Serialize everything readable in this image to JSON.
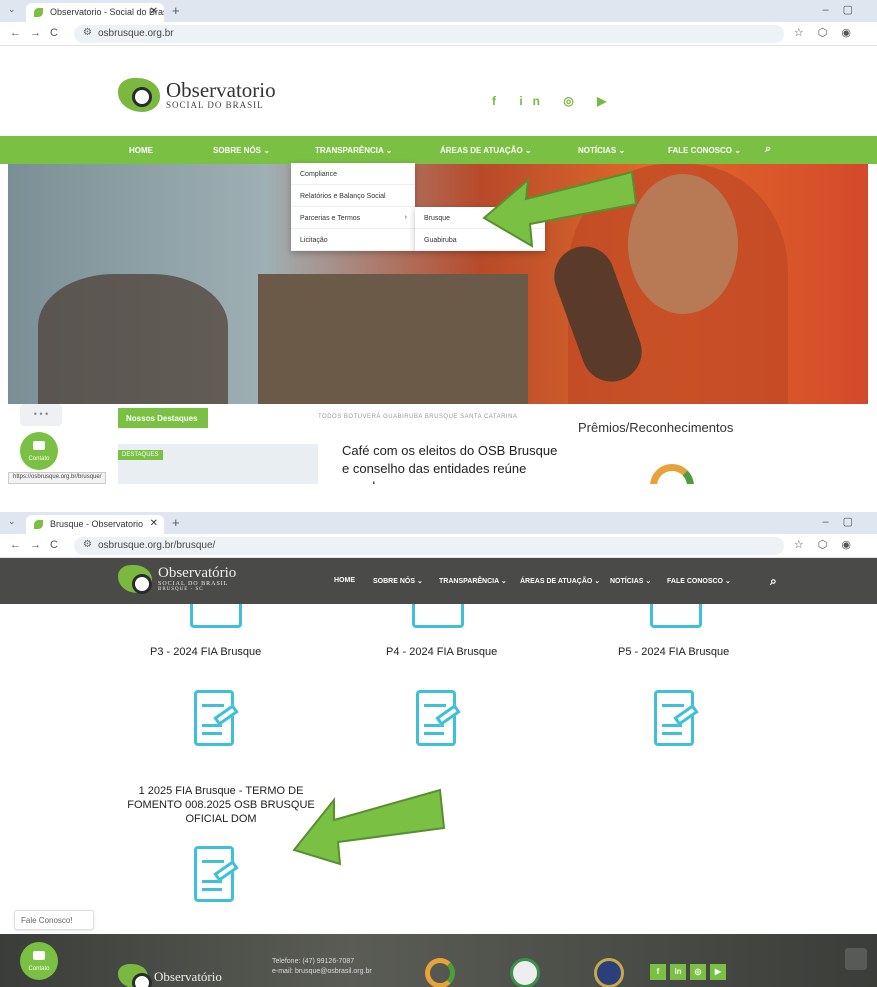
{
  "shot1": {
    "tab_title": "Observatorio - Social do Brasi",
    "url": "osbrusque.org.br",
    "logo": {
      "title": "Observatorio",
      "subtitle": "SOCIAL DO BRASIL"
    },
    "social": "f in ◎ ▶",
    "menu": [
      "HOME",
      "SOBRE NÓS ⌄",
      "TRANSPARÊNCIA ⌄",
      "ÁREAS DE ATUAÇÃO ⌄",
      "NOTÍCIAS ⌄",
      "FALE CONOSCO ⌄"
    ],
    "dropdown": [
      "Compliance",
      "Relatórios e Balanço Social",
      "Parcerias e Termos",
      "Licitação"
    ],
    "submenu": [
      "Brusque",
      "Guabiruba"
    ],
    "highlights_label": "Nossos Destaques",
    "filters": "TODOS   BOTUVERÁ   GUABIRUBA   BRUSQUE   SANTA CATARINA",
    "awards": "Prêmios/Reconhecimentos",
    "news_title": "Café com os eleitos do OSB Brusque e conselho das entidades reúne grande",
    "thumb_tag": "DESTAQUES",
    "status_url": "https://osbrusque.org.br/brusque/",
    "dots": "• • •",
    "chat_label": "Contato"
  },
  "shot2": {
    "tab_title": "Brusque - Observatorio",
    "url": "osbrusque.org.br/brusque/",
    "logo": {
      "title": "Observatório",
      "subtitle": "SOCIAL DO BRASIL",
      "sub2": "BRUSQUE - SC"
    },
    "menu": [
      "HOME",
      "SOBRE NÓS ⌄",
      "TRANSPARÊNCIA ⌄",
      "ÁREAS DE ATUAÇÃO ⌄",
      "NOTÍCIAS ⌄",
      "FALE CONOSCO ⌄"
    ],
    "docs": [
      "P3 - 2024 FIA Brusque",
      "P4 - 2024 FIA Brusque",
      "P5 - 2024 FIA Brusque"
    ],
    "doc_long": [
      "1 2025 FIA Brusque - TERMO DE",
      "FOMENTO 008.2025 OSB BRUSQUE",
      "OFICIAL DOM"
    ],
    "fale": "Fale Conosco!",
    "footer_logo": "Observatório",
    "footer_tel": "Telefone: (47) 99126-7087",
    "footer_email": "e-mail: brusque@osbrasil.org.br",
    "chat_label": "Contato"
  },
  "colors": {
    "green": "#7ac143",
    "dark": "#4a4a48",
    "doc": "#3ec0d8"
  }
}
